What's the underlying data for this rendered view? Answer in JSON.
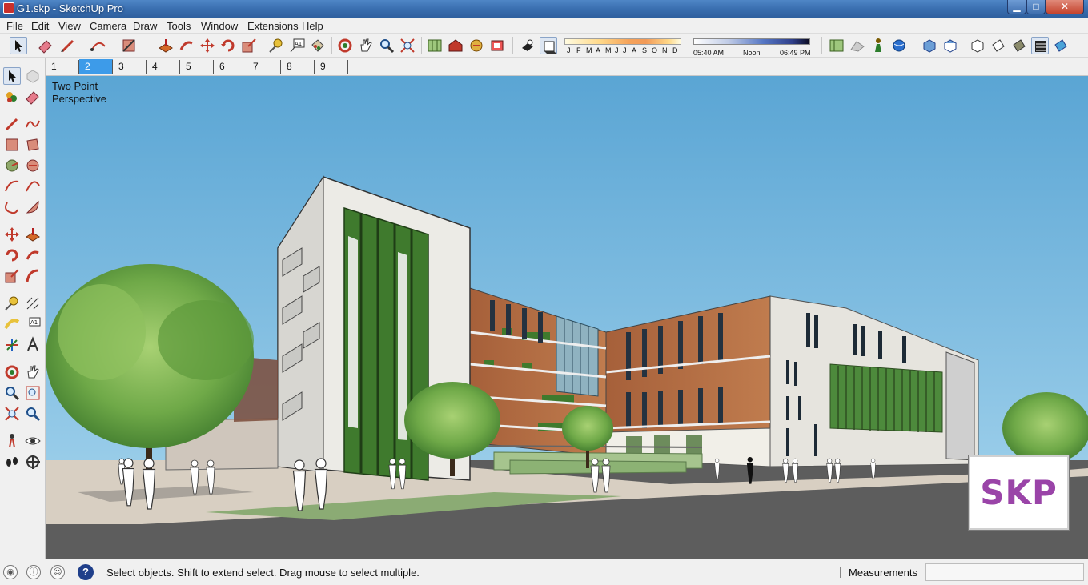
{
  "window": {
    "title": "G1.skp - SketchUp Pro",
    "minimize_glyph": "▁",
    "maximize_glyph": "□",
    "close_glyph": "✕"
  },
  "menu": {
    "items": [
      "File",
      "Edit",
      "View",
      "Camera",
      "Draw",
      "Tools",
      "Window",
      "Extensions",
      "Help"
    ]
  },
  "toolbar": {
    "shadow_months": [
      "J",
      "F",
      "M",
      "A",
      "M",
      "J",
      "J",
      "A",
      "S",
      "O",
      "N",
      "D"
    ],
    "time_labels": [
      "05:40 AM",
      "Noon",
      "06:49 PM"
    ]
  },
  "scenes": {
    "tabs": [
      "1",
      "2",
      "3",
      "4",
      "5",
      "6",
      "7",
      "8",
      "9"
    ],
    "active_index": 1
  },
  "viewport": {
    "camera_line1": "Two Point",
    "camera_line2": "Perspective",
    "watermark": "SKP"
  },
  "statusbar": {
    "help_glyph": "?",
    "message": "Select objects. Shift to extend select. Drag mouse to select multiple.",
    "measurements_label": "Measurements",
    "measurements_value": ""
  },
  "colors": {
    "sky_top": "#5aa5d4",
    "sky_bottom": "#a8d6ee",
    "building_white": "#ecebe6",
    "brick": "#b2683f",
    "glass_green": "#4d8a3c",
    "active_tab": "#3d9be9",
    "watermark_purple": "#9a44a8"
  }
}
